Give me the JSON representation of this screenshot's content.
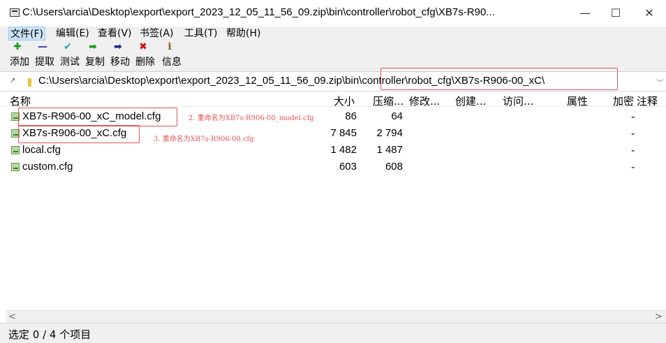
{
  "window": {
    "title": "C:\\Users\\arcia\\Desktop\\export\\export_2023_12_05_11_56_09.zip\\bin\\controller\\robot_cfg\\XB7s-R90...",
    "minimize": "—",
    "maximize": "☐",
    "close": "✕"
  },
  "menu": [
    {
      "label": "文件(F)"
    },
    {
      "label": "编辑(E)"
    },
    {
      "label": "查看(V)"
    },
    {
      "label": "书签(A)"
    },
    {
      "label": "工具(T)"
    },
    {
      "label": "帮助(H)"
    }
  ],
  "toolbar": [
    {
      "label": "添加",
      "icon": "plus-icon",
      "glyph": "✚",
      "color": "#1a9a1a"
    },
    {
      "label": "提取",
      "icon": "minus-icon",
      "glyph": "—",
      "color": "#2a3aa0"
    },
    {
      "label": "测试",
      "icon": "check-icon",
      "glyph": "✔",
      "color": "#1aa0c0"
    },
    {
      "label": "复制",
      "icon": "copy-arrow-icon",
      "glyph": "➡",
      "color": "#1a9a1a"
    },
    {
      "label": "移动",
      "icon": "move-arrow-icon",
      "glyph": "➡",
      "color": "#1a2a8a"
    },
    {
      "label": "删除",
      "icon": "delete-icon",
      "glyph": "✖",
      "color": "#d01010"
    },
    {
      "label": "信息",
      "icon": "info-icon",
      "glyph": "i",
      "color": "#806010"
    }
  ],
  "address": {
    "path": "C:\\Users\\arcia\\Desktop\\export\\export_2023_12_05_11_56_09.zip\\bin\\controller\\robot_cfg\\XB7s-R906-00_xC\\"
  },
  "columns": [
    {
      "label": "名称"
    },
    {
      "label": "大小"
    },
    {
      "label": "压缩..."
    },
    {
      "label": "修改..."
    },
    {
      "label": "创建..."
    },
    {
      "label": "访问..."
    },
    {
      "label": "属性"
    },
    {
      "label": "加密"
    },
    {
      "label": "注释"
    }
  ],
  "files": [
    {
      "name": "XB7s-R906-00_xC_model.cfg",
      "size": "86",
      "compressed": "64",
      "encrypted": "-"
    },
    {
      "name": "XB7s-R906-00_xC.cfg",
      "size": "7 845",
      "compressed": "2 794",
      "encrypted": "-"
    },
    {
      "name": "local.cfg",
      "size": "1 482",
      "compressed": "1 487",
      "encrypted": "-"
    },
    {
      "name": "custom.cfg",
      "size": "603",
      "compressed": "608",
      "encrypted": "-"
    }
  ],
  "annotations": [
    {
      "text": "2. 重命名为XB7s-R906-00_model.cfg"
    },
    {
      "text": "3. 重命名为XB7s-R906-00.cfg"
    }
  ],
  "status": {
    "text": "选定 0 / 4 个项目"
  },
  "colors": {
    "highlight_red": "#e05555",
    "menu_active": "#cde4f7"
  }
}
